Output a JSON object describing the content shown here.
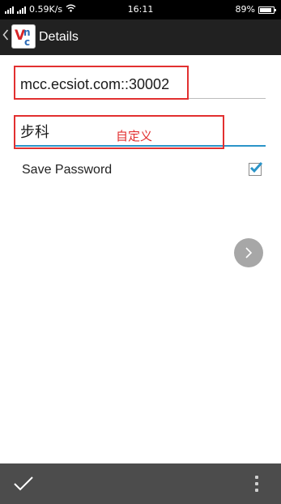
{
  "status_bar": {
    "left_text": "0.59K/s",
    "time": "16:11",
    "battery": "89%",
    "battery_level": 0.89
  },
  "action_bar": {
    "title": "Details",
    "logo_letters": {
      "v": "V",
      "n": "n",
      "c": "c"
    }
  },
  "form": {
    "host_value": "mcc.ecsiot.com::30002",
    "name_value": "步科",
    "annotation": "自定义",
    "save_password_label": "Save Password",
    "save_password_checked": true
  },
  "icons": {
    "back": "chevron-left-icon",
    "next": "chevron-right-icon",
    "confirm": "check-icon",
    "overflow": "more-vert-icon"
  },
  "colors": {
    "accent": "#2b94c8",
    "annotation": "#e23030",
    "bottom_bar": "#4c4c4c",
    "action_bar": "#212121"
  }
}
